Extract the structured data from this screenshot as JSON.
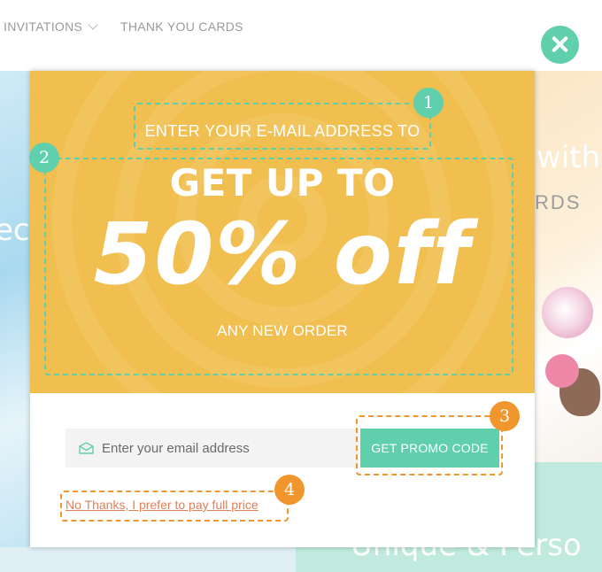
{
  "nav": {
    "invitations": "INVITATIONS",
    "thank_you_cards": "THANK YOU CARDS"
  },
  "background": {
    "left_text": "ec",
    "right_text_1": "with",
    "right_text_2": "RDS",
    "bottom_text": "Unique & Perso"
  },
  "popup": {
    "intro": "ENTER YOUR E-MAIL ADDRESS TO",
    "headline": "GET UP TO",
    "offer": "50% off",
    "sub": "ANY NEW ORDER",
    "email_placeholder": "Enter your email address",
    "email_value": "",
    "promo_button": "GET PROMO CODE",
    "decline_link": "No Thanks, I prefer to pay full price"
  },
  "icons": {
    "close": "close-icon",
    "mail": "mail-icon",
    "nav_chevron": "chevron-down-icon"
  },
  "annotations": [
    "1",
    "2",
    "3",
    "4"
  ],
  "colors": {
    "hero_yellow": "#f1bf4f",
    "accent_teal": "#5fcfac",
    "annotation_orange": "#f0962c",
    "link_orange": "#e07f5a"
  }
}
